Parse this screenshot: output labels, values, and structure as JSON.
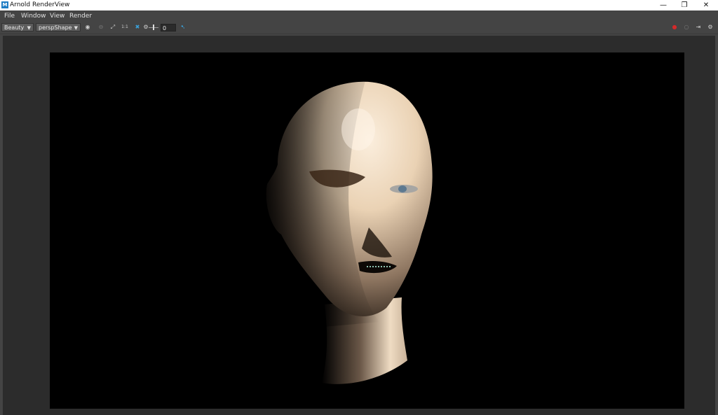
{
  "window": {
    "title": "Arnold RenderView",
    "app_icon": "maya-app-icon",
    "controls": {
      "minimize": "—",
      "restore": "❐",
      "close": "✕"
    }
  },
  "menu": {
    "items": [
      "File",
      "Window",
      "View",
      "Render"
    ]
  },
  "toolbar": {
    "aov_select": "Beauty",
    "camera_select": "perspShape",
    "frame_value": "0",
    "icons": [
      "render-region-icon",
      "snapshot-icon",
      "crop-icon",
      "fit-icon",
      "close-x-icon",
      "settings-gear-icon",
      "pointer-icon"
    ],
    "right_icons": [
      "render-record-icon",
      "stop-render-icon",
      "sidebar-toggle-icon",
      "options-gear-icon"
    ]
  },
  "colors": {
    "ui_bg": "#444444",
    "viewport_bg": "#2c2c2c",
    "render_bg": "#000000",
    "record_red": "#d42a2a",
    "skin": "#efd8bc"
  }
}
